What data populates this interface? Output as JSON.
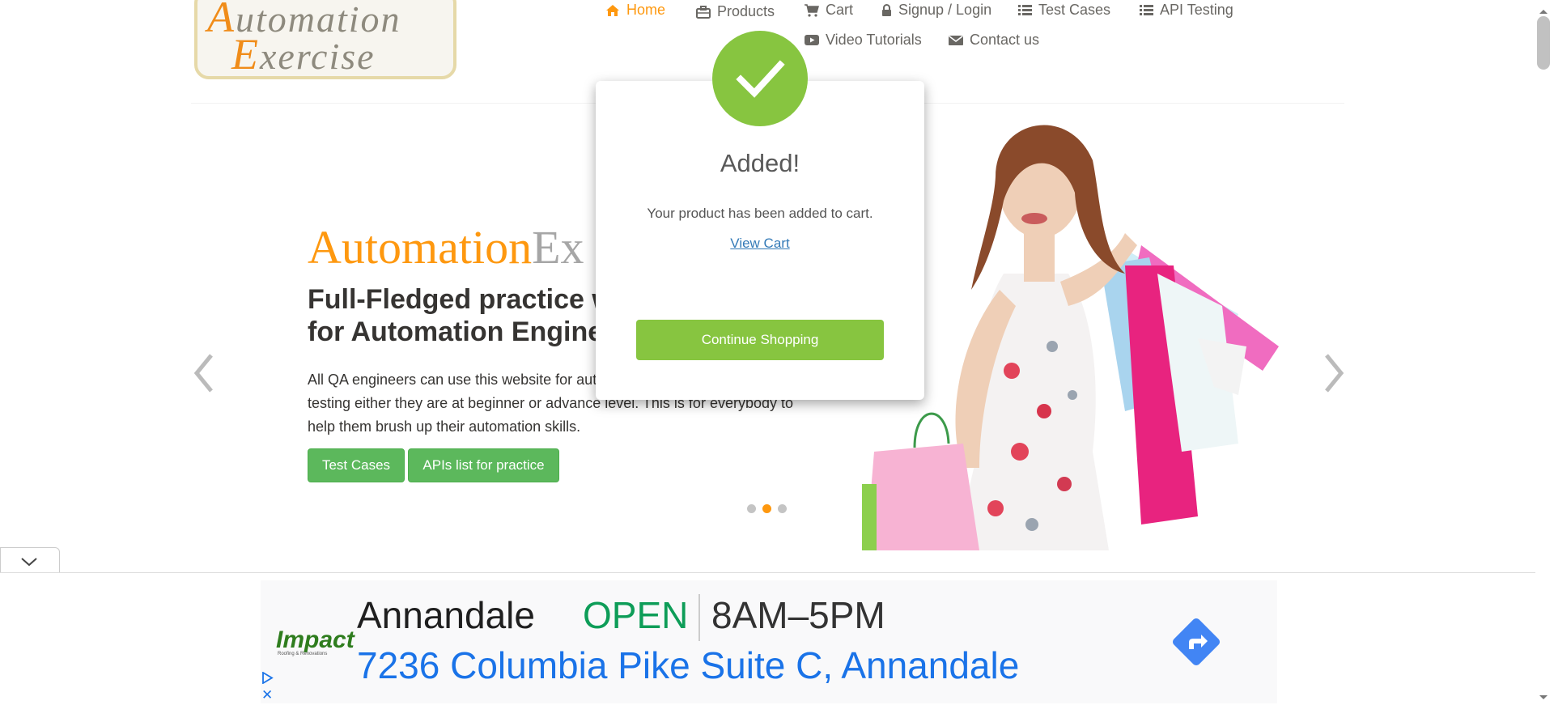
{
  "logo": {
    "line1_cap": "A",
    "line1_rest": "utomation",
    "line2_cap": "E",
    "line2_rest": "xercise"
  },
  "nav": {
    "home": "Home",
    "products": "Products",
    "cart": "Cart",
    "signup": "Signup / Login",
    "test_cases": "Test Cases",
    "api_testing": "API Testing",
    "video_tutorials": "Video Tutorials",
    "contact": "Contact us"
  },
  "slider": {
    "brand_orange": "Automation",
    "brand_grey": "Ex",
    "headline": "Full-Fledged practice website for Automation Engineers",
    "description": "All QA engineers can use this website for automation practice and API testing either they are at beginner or advance level. This is for everybody to help them brush up their automation skills.",
    "btn_test_cases": "Test Cases",
    "btn_apis": "APIs list for practice",
    "active_slide": 2,
    "slide_count": 3
  },
  "modal": {
    "title": "Added!",
    "body": "Your product has been added to cart.",
    "view_cart": "View Cart",
    "continue": "Continue Shopping"
  },
  "ad": {
    "business_name": "Annandale",
    "status": "OPEN",
    "hours": "8AM–5PM",
    "address": "7236 Columbia Pike Suite C, Annandale",
    "logo_text": "Impact",
    "logo_sub": "Roofing & Renovations"
  },
  "colors": {
    "accent": "#fe980f",
    "modal_green": "#87c540",
    "button_green": "#5cb85c",
    "link_blue": "#337ab7"
  }
}
